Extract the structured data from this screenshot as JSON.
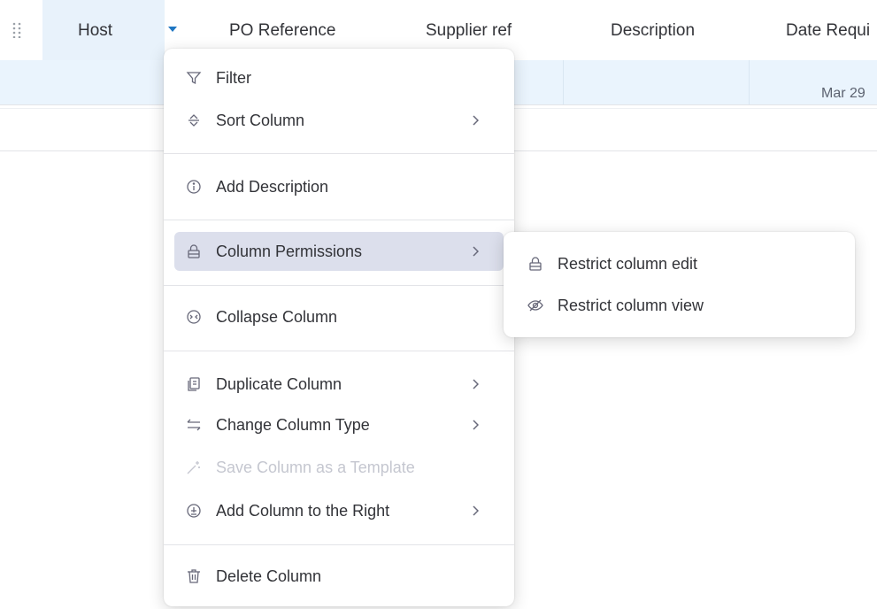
{
  "table": {
    "columns": [
      "Host",
      "PO Reference",
      "Supplier ref",
      "Description",
      "Date Requi"
    ],
    "row_date": "Mar 29"
  },
  "context_menu": {
    "items": [
      {
        "label": "Filter",
        "icon": "filter-icon",
        "has_submenu": false,
        "disabled": false
      },
      {
        "label": "Sort Column",
        "icon": "sort-icon",
        "has_submenu": true,
        "disabled": false
      },
      {
        "label": "Add Description",
        "icon": "info-icon",
        "has_submenu": false,
        "disabled": false
      },
      {
        "label": "Column Permissions",
        "icon": "lock-icon",
        "has_submenu": true,
        "disabled": false,
        "active": true
      },
      {
        "label": "Collapse Column",
        "icon": "collapse-icon",
        "has_submenu": false,
        "disabled": false
      },
      {
        "label": "Duplicate Column",
        "icon": "duplicate-icon",
        "has_submenu": true,
        "disabled": false
      },
      {
        "label": "Change Column Type",
        "icon": "swap-icon",
        "has_submenu": true,
        "disabled": false
      },
      {
        "label": "Save Column as a Template",
        "icon": "magic-wand-icon",
        "has_submenu": false,
        "disabled": true
      },
      {
        "label": "Add Column to the Right",
        "icon": "add-circle-icon",
        "has_submenu": true,
        "disabled": false
      },
      {
        "label": "Delete Column",
        "icon": "trash-icon",
        "has_submenu": false,
        "disabled": false
      }
    ]
  },
  "permissions_submenu": {
    "items": [
      {
        "label": "Restrict column edit",
        "icon": "lock-icon"
      },
      {
        "label": "Restrict column view",
        "icon": "eye-off-icon"
      }
    ]
  },
  "colors": {
    "accent": "#1f76c2",
    "header_highlight": "#e8f2fb",
    "row_background": "#eaf4fd",
    "active_item": "#dcdfec",
    "disabled_text": "#c5c7d0"
  }
}
